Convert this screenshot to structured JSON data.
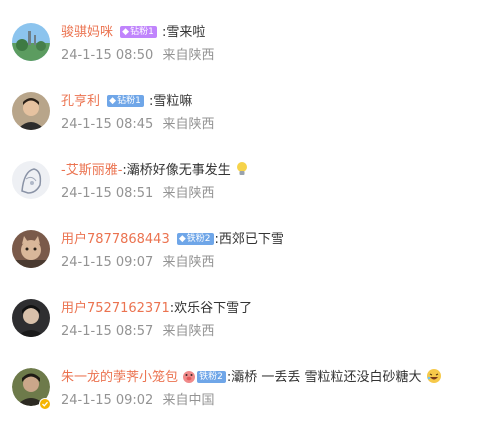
{
  "comments": [
    {
      "username": "骏骐妈咪",
      "badge": "钻粉1",
      "badge_type": "diamond",
      "text": ":雪来啦",
      "time": "24-1-15 08:50",
      "location": "来自陕西",
      "avatar_icon": "landscape-avatar"
    },
    {
      "username": "孔亨利",
      "badge": "钻粉1",
      "badge_type": "iron",
      "text": ":雪粒嘛",
      "time": "24-1-15 08:45",
      "location": "来自陕西",
      "avatar_icon": "man-portrait-avatar"
    },
    {
      "username": "-艾斯丽雅-",
      "badge": "",
      "text": ":灞桥好像无事发生",
      "emoji": "bulb-emoji",
      "time": "24-1-15 08:51",
      "location": "来自陕西",
      "avatar_icon": "sketch-avatar"
    },
    {
      "username": "用户7877868443",
      "badge": "铁粉2",
      "badge_type": "iron",
      "text": ":西郊已下雪",
      "time": "24-1-15 09:07",
      "location": "来自陕西",
      "avatar_icon": "cat-avatar"
    },
    {
      "username": "用户7527162371",
      "badge": "",
      "text": ":欢乐谷下雪了",
      "time": "24-1-15 08:57",
      "location": "来自陕西",
      "avatar_icon": "dark-portrait-avatar"
    },
    {
      "username": "朱一龙的荸荠小笼包",
      "badge": "铁粉2",
      "badge_type": "iron",
      "text": ":灞桥  一丢丢 雪粒粒还没白砂糖大",
      "emoji": "laughing-emoji",
      "time": "24-1-15 09:02",
      "location": "来自中国",
      "avatar_icon": "verified-portrait-avatar",
      "verified": true
    }
  ],
  "colors": {
    "username": "#eb7350",
    "meta": "#939393",
    "diamond_badge": "#c084fc",
    "iron_badge": "#6fa6e8"
  }
}
